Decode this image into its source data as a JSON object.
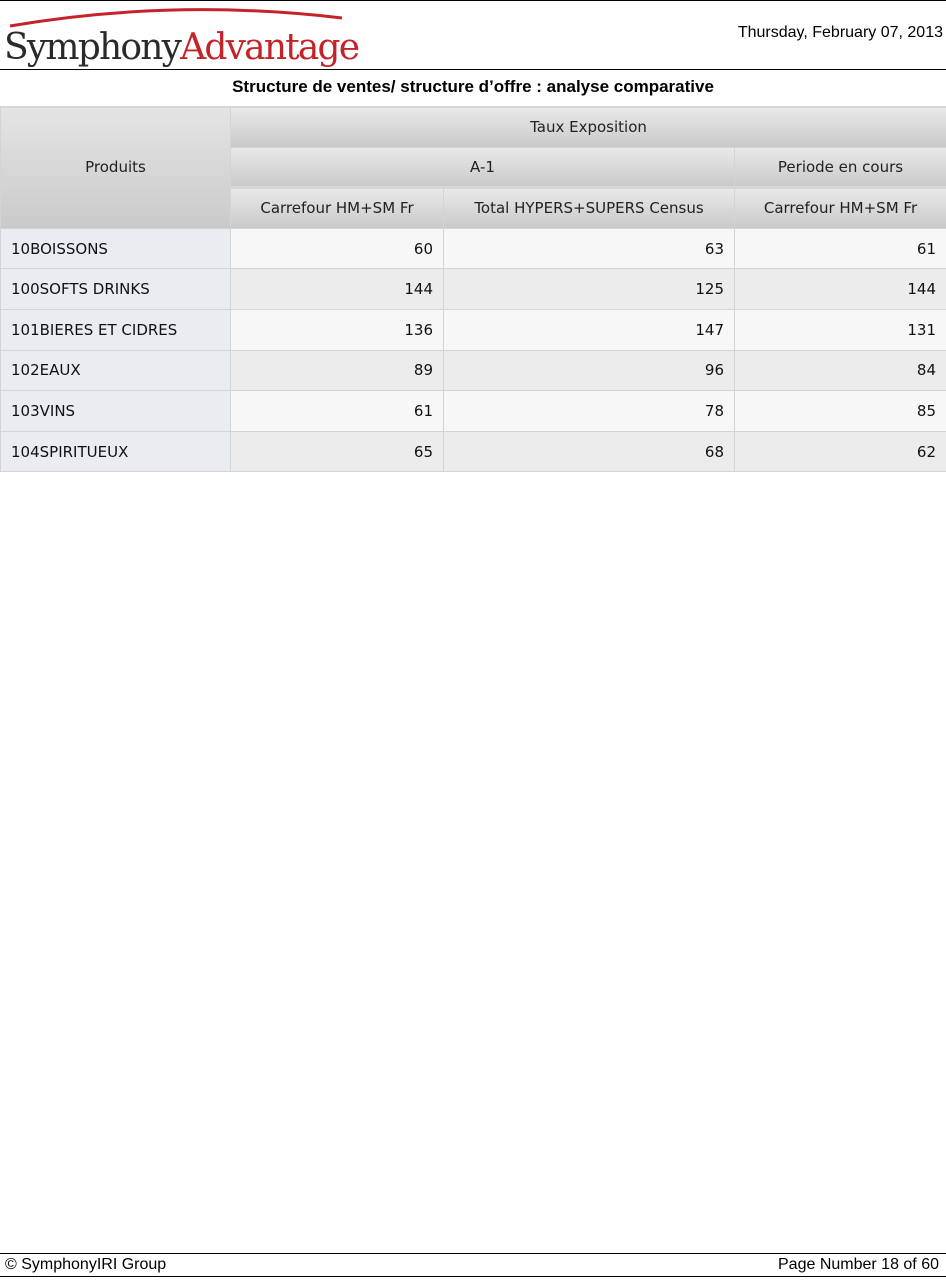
{
  "header": {
    "logo_part1": "Symphony",
    "logo_part2": "Advantage",
    "date": "Thursday, February 07, 2013"
  },
  "report": {
    "title": "Structure de ventes/ structure d’offre : analyse comparative"
  },
  "table": {
    "product_header": "Produits",
    "measure_header": "Taux Exposition",
    "period_a1": "A-1",
    "period_current": "Periode en cours",
    "market_1": "Carrefour HM+SM Fr",
    "market_2": "Total HYPERS+SUPERS Census",
    "market_3": "Carrefour HM+SM Fr",
    "rows": [
      {
        "product": "10BOISSONS",
        "v1": "60",
        "v2": "63",
        "v3": "61"
      },
      {
        "product": "100SOFTS DRINKS",
        "v1": "144",
        "v2": "125",
        "v3": "144"
      },
      {
        "product": "101BIERES ET CIDRES",
        "v1": "136",
        "v2": "147",
        "v3": "131"
      },
      {
        "product": "102EAUX",
        "v1": "89",
        "v2": "96",
        "v3": "84"
      },
      {
        "product": "103VINS",
        "v1": "61",
        "v2": "78",
        "v3": "85"
      },
      {
        "product": "104SPIRITUEUX",
        "v1": "65",
        "v2": "68",
        "v3": "62"
      }
    ]
  },
  "footer": {
    "copyright": "© SymphonyIRI Group",
    "page_number": "Page Number 18 of 60"
  },
  "colors": {
    "logo_red": "#c5232a",
    "logo_dark": "#2a2a2a",
    "label_cell_bg": "#e9edf2",
    "header_gradient_top": "#e9e9e9",
    "header_gradient_bottom": "#c9c9c9"
  }
}
